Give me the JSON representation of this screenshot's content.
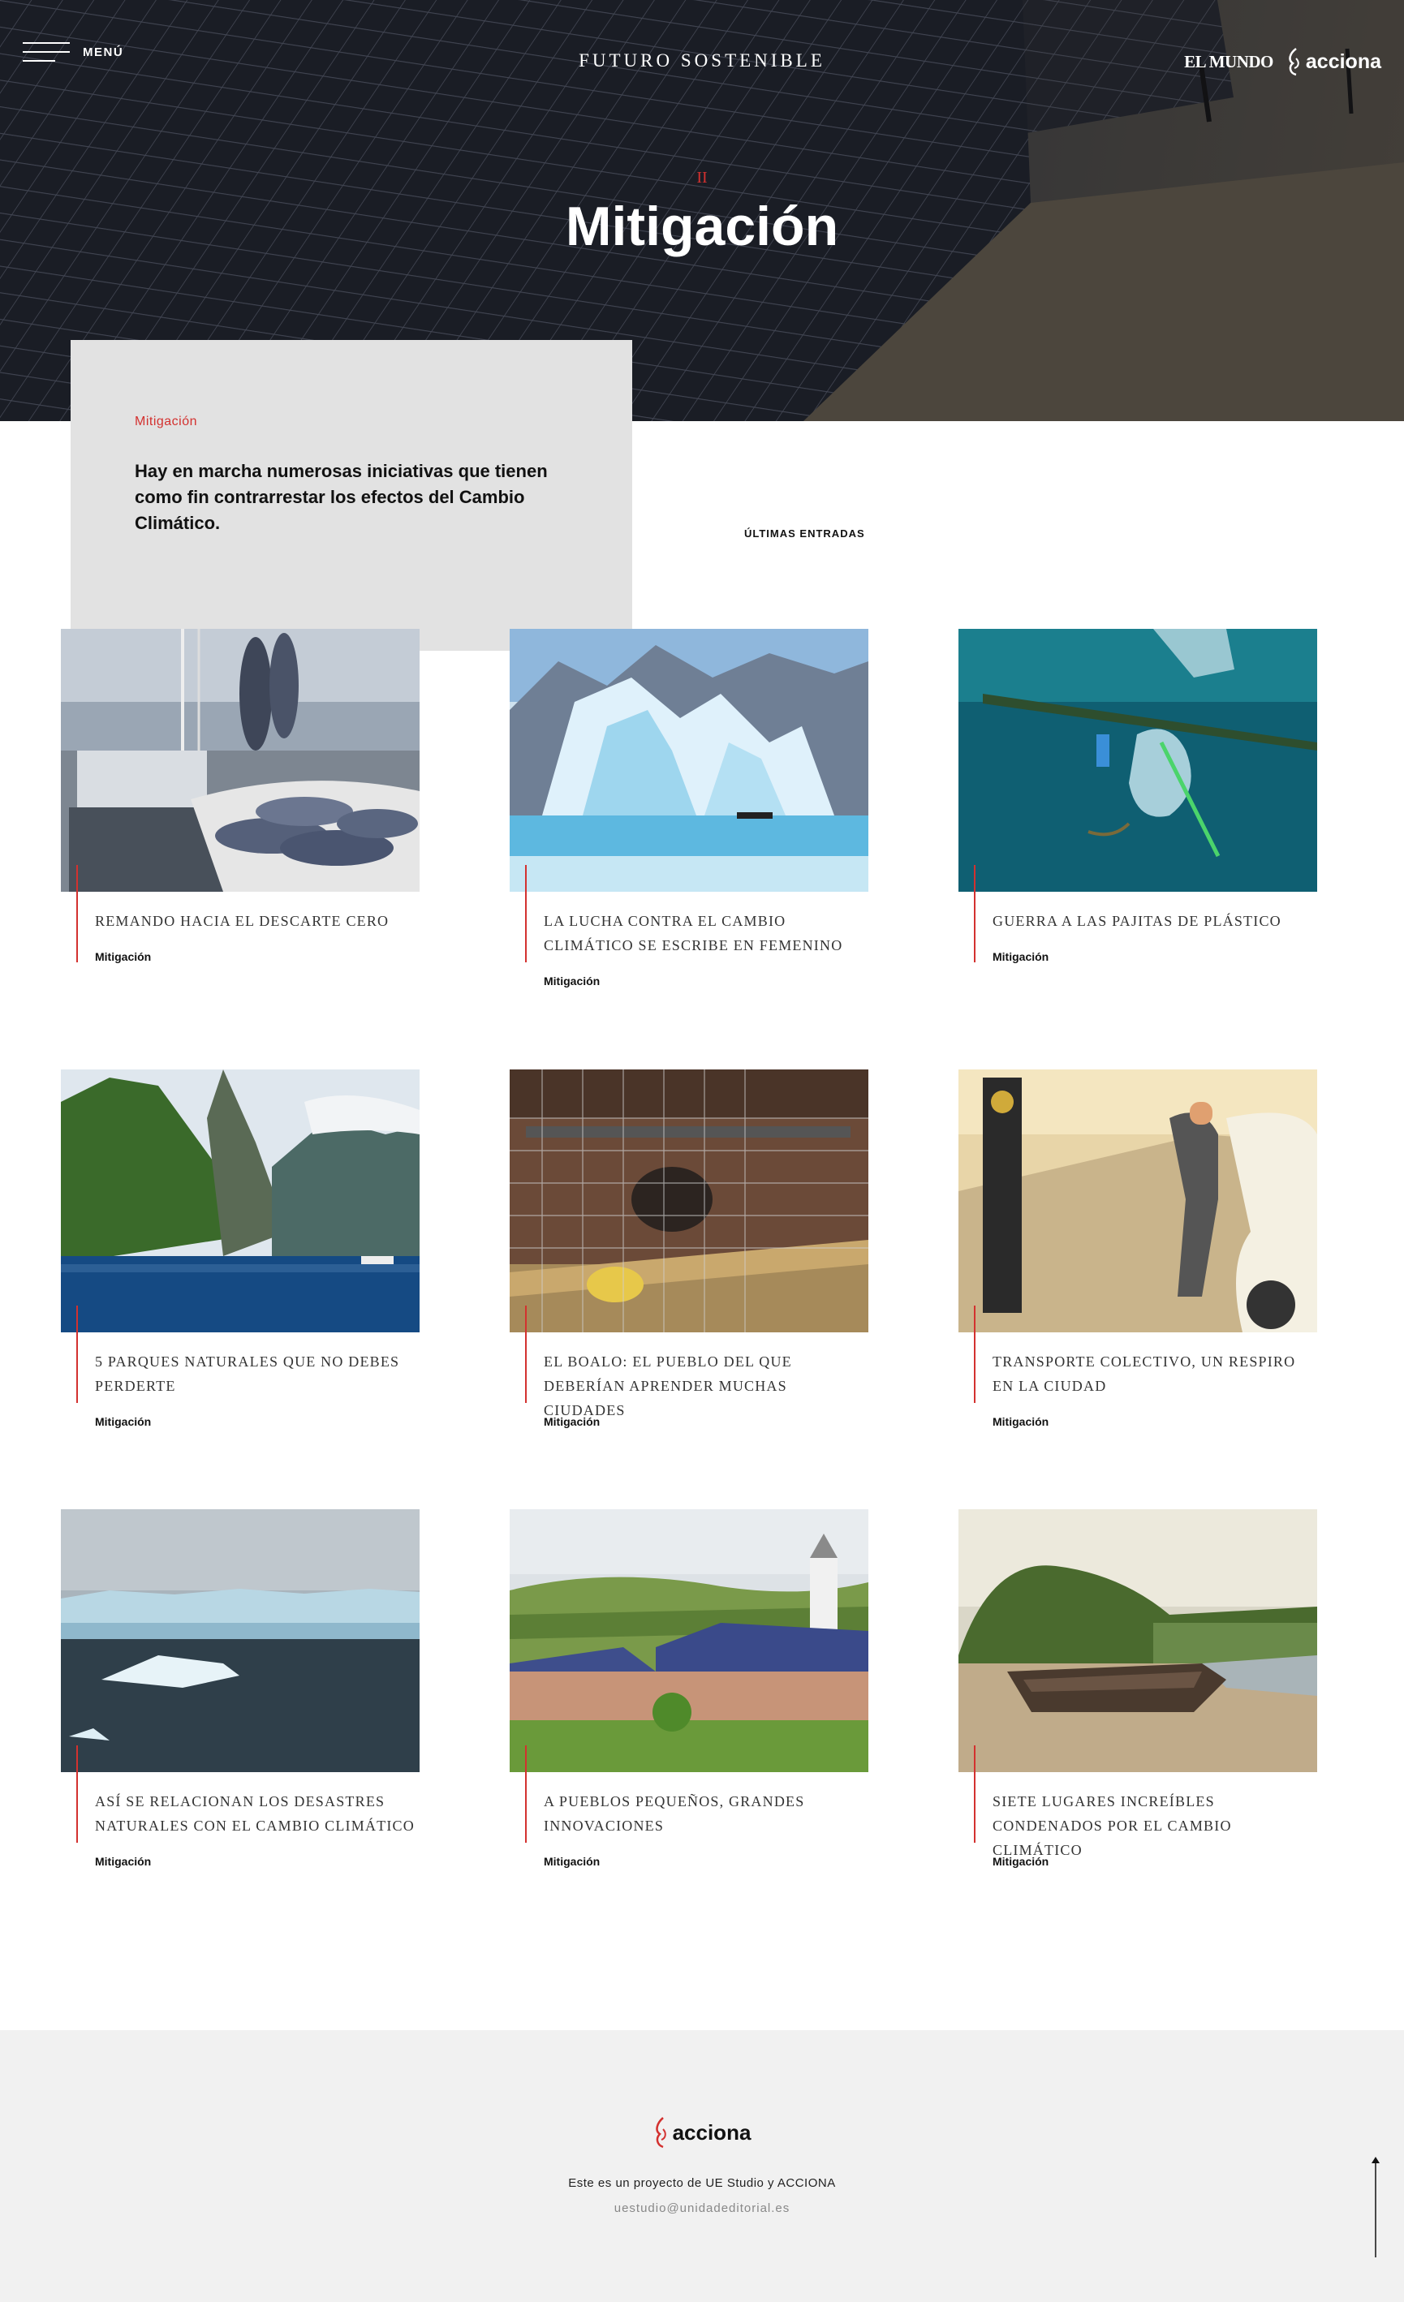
{
  "header": {
    "menu_label": "MENÚ",
    "site_title": "FUTURO SOSTENIBLE",
    "partner_logo": "EL MUNDO",
    "brand_logo": "acciona"
  },
  "hero": {
    "number": "II",
    "title": "Mitigación"
  },
  "intro": {
    "category": "Mitigación",
    "text": "Hay en marcha numerosas iniciativas que tienen como fin contrarrestar los efectos del Cambio Climático."
  },
  "latest_label": "ÚLTIMAS ENTRADAS",
  "articles": [
    {
      "title": "Remando hacia el descarte cero",
      "category": "Mitigación",
      "image": "fishing-boat-tuna"
    },
    {
      "title": "La lucha contra el cambio climático se escribe en femenino",
      "category": "Mitigación",
      "image": "glacier-boat"
    },
    {
      "title": "Guerra a las pajitas de plástico",
      "category": "Mitigación",
      "image": "ocean-plastic"
    },
    {
      "title": "5 parques naturales que no debes perderte",
      "category": "Mitigación",
      "image": "fjord-mountains"
    },
    {
      "title": "El Boalo: el pueblo del que deberían aprender muchas ciudades",
      "category": "Mitigación",
      "image": "hen-coop"
    },
    {
      "title": "Transporte colectivo, un respiro en la ciudad",
      "category": "Mitigación",
      "image": "woman-electric-car"
    },
    {
      "title": "Así se relacionan los desastres naturales con el cambio climático",
      "category": "Mitigación",
      "image": "iceberg-sea"
    },
    {
      "title": "A pueblos pequeños, grandes innovaciones",
      "category": "Mitigación",
      "image": "village-solar-roofs"
    },
    {
      "title": "Siete lugares increíbles condenados por el cambio climático",
      "category": "Mitigación",
      "image": "shipwreck-beach"
    }
  ],
  "footer": {
    "logo": "acciona",
    "text": "Este es un proyecto de UE Studio y ACCIONA",
    "email": "uestudio@unidadeditorial.es"
  },
  "icons": [
    "menu-icon",
    "acciona-leaf-icon",
    "arrow-up-icon"
  ],
  "colors": {
    "accent": "#d3312f",
    "intro_bg": "#e2e2e2",
    "footer_bg": "#f1f1f1"
  }
}
